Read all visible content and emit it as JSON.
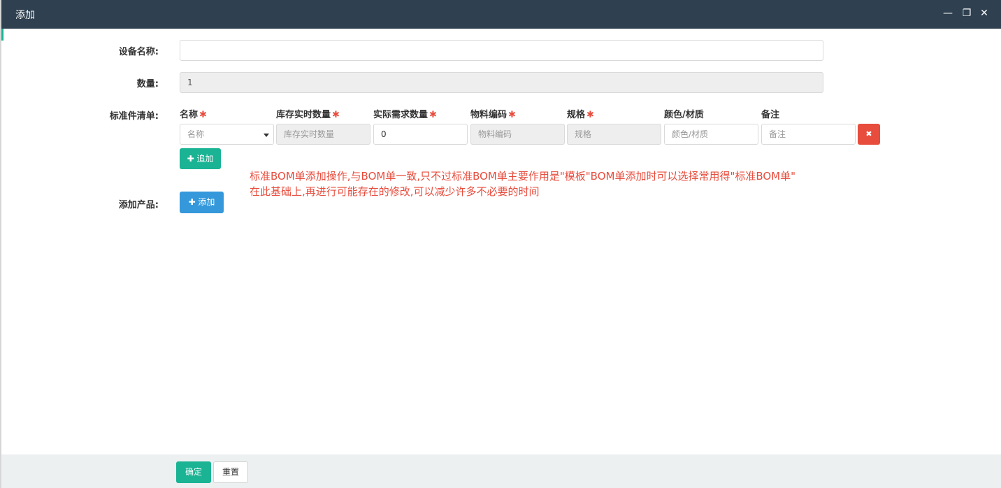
{
  "window": {
    "title": "添加",
    "minimize_glyph": "—",
    "restore_glyph": "❐",
    "close_glyph": "✕"
  },
  "form": {
    "device_name": {
      "label": "设备名称:",
      "value": ""
    },
    "quantity": {
      "label": "数量:",
      "value": "1"
    },
    "standard_parts": {
      "label": "标准件清单:",
      "columns": [
        {
          "label": "名称",
          "required": true
        },
        {
          "label": "库存实时数量",
          "required": true
        },
        {
          "label": "实际需求数量",
          "required": true
        },
        {
          "label": "物料编码",
          "required": true
        },
        {
          "label": "规格",
          "required": true
        },
        {
          "label": "颜色/材质",
          "required": false
        },
        {
          "label": "备注",
          "required": false
        }
      ],
      "row": {
        "name_placeholder": "名称",
        "stock_placeholder": "库存实时数量",
        "demand_value": "0",
        "code_placeholder": "物料编码",
        "spec_placeholder": "规格",
        "color_placeholder": "颜色/材质",
        "remark_placeholder": "备注"
      },
      "add_row_label": "✚ 追加",
      "delete_glyph": "✖"
    },
    "add_product": {
      "label": "添加产品:",
      "button_label": "✚ 添加"
    }
  },
  "note": {
    "line1": "标准BOM单添加操作,与BOM单一致,只不过标准BOM单主要作用是\"模板\"BOM单添加时可以选择常用得\"标准BOM单\"",
    "line2": "在此基础上,再进行可能存在的修改,可以减少许多不必要的时间"
  },
  "footer": {
    "confirm_label": "确定",
    "reset_label": "重置"
  },
  "colors": {
    "titlebar": "#2f4050",
    "primary": "#1ab394",
    "info": "#3498db",
    "danger": "#e74c3c",
    "note_text": "#e74c3c"
  }
}
